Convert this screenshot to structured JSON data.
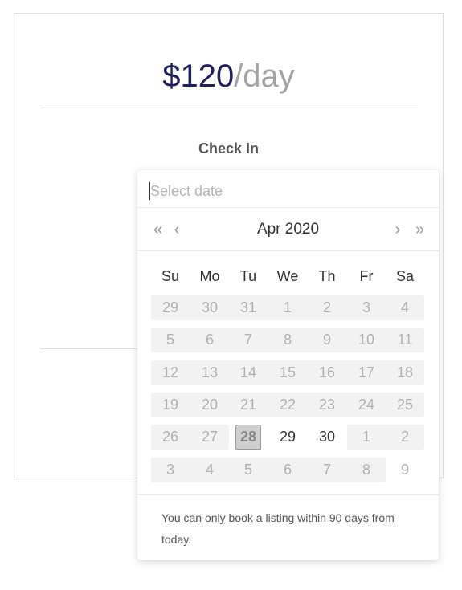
{
  "listing": {
    "price_amount": "$120",
    "price_unit": "/day",
    "checkin_label": "Check In"
  },
  "datepicker": {
    "input_placeholder": "Select date",
    "input_value": "",
    "nav": {
      "prev_year": "«",
      "prev_month": "‹",
      "next_month": "›",
      "next_year": "»"
    },
    "nav_icons": [
      "double-chevron-left-icon",
      "chevron-left-icon",
      "chevron-right-icon",
      "double-chevron-right-icon"
    ],
    "month_title": "Apr 2020",
    "weekdays": [
      "Su",
      "Mo",
      "Tu",
      "We",
      "Th",
      "Fr",
      "Sa"
    ],
    "weeks": [
      [
        "29",
        "30",
        "31",
        "1",
        "2",
        "3",
        "4"
      ],
      [
        "5",
        "6",
        "7",
        "8",
        "9",
        "10",
        "11"
      ],
      [
        "12",
        "13",
        "14",
        "15",
        "16",
        "17",
        "18"
      ],
      [
        "19",
        "20",
        "21",
        "22",
        "23",
        "24",
        "25"
      ],
      [
        "26",
        "27",
        "28",
        "29",
        "30",
        "1",
        "2"
      ],
      [
        "3",
        "4",
        "5",
        "6",
        "7",
        "8",
        "9"
      ]
    ],
    "today": "28",
    "enabled_days": [
      "29",
      "30"
    ],
    "note": "You can only book a listing within 90 days from today."
  },
  "colors": {
    "price": "#1e2160",
    "unit": "#a3a3a3",
    "disabled_day_bg": "#f2f2f2",
    "today_bg": "#cfcfcf"
  }
}
